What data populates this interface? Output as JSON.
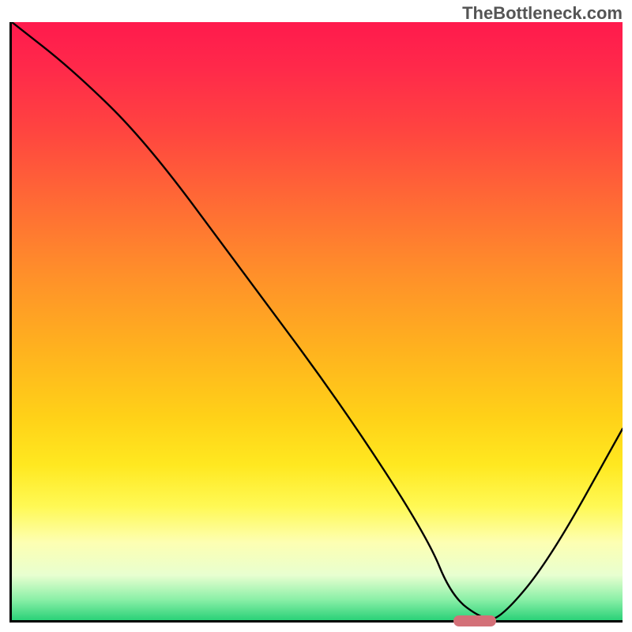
{
  "watermark": "TheBottleneck.com",
  "chart_data": {
    "type": "line",
    "title": "",
    "xlabel": "",
    "ylabel": "",
    "xlim": [
      0,
      100
    ],
    "ylim": [
      0,
      100
    ],
    "series": [
      {
        "name": "bottleneck-curve",
        "x": [
          0,
          10,
          22,
          38,
          54,
          68,
          72,
          77,
          80,
          88,
          100
        ],
        "values": [
          100,
          92,
          80,
          58,
          36,
          14,
          4,
          0.2,
          0.2,
          10,
          32
        ]
      }
    ],
    "optimal_marker": {
      "x_start": 72,
      "x_end": 79,
      "y": 0.2
    },
    "gradient_colors": {
      "top": "#ff1a4d",
      "mid_upper": "#ff8f2a",
      "mid_lower": "#ffe820",
      "bottom": "#2ad178"
    }
  }
}
